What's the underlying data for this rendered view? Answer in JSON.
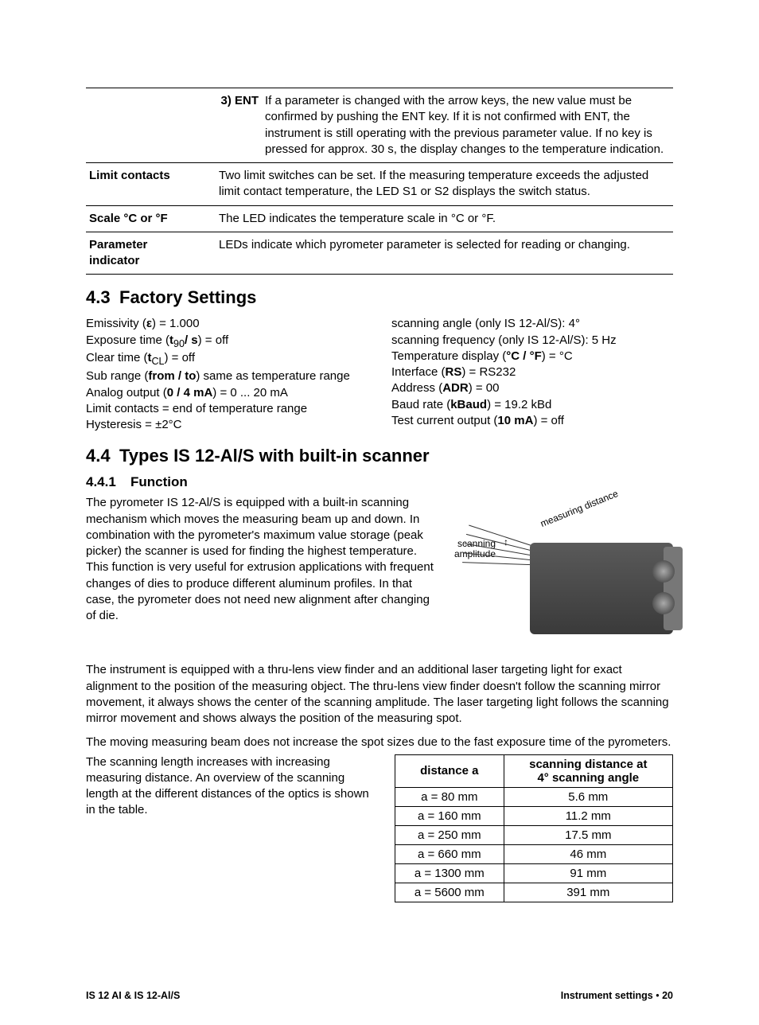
{
  "defs": {
    "row1_key": "3) ENT",
    "row1_text": "If a parameter is changed with the arrow keys, the new value must be confirmed by pushing the ENT key. If it is not confirmed with ENT, the instrument is still operating with the previous parameter value. If no key is pressed for approx. 30 s, the display changes to the temperature indication.",
    "row2_label": "Limit contacts",
    "row2_text": "Two limit switches can be set. If the measuring temperature exceeds the adjusted limit contact temperature, the LED S1 or S2 displays the switch status.",
    "row3_label": "Scale °C or °F",
    "row3_text": "The LED indicates the temperature scale in °C or °F.",
    "row4_label_l1": "Parameter",
    "row4_label_l2": "indicator",
    "row4_text": "LEDs indicate which pyrometer parameter is selected for reading or changing."
  },
  "sec43": {
    "num": "4.3",
    "title": "Factory Settings",
    "left": {
      "l1_a": "Emissivity (",
      "l1_b": ") = 1.000",
      "l2_a": "Exposure time (",
      "l2_b": "t",
      "l2_c": "90",
      "l2_d": "/ s",
      "l2_e": ") = off",
      "l3_a": "Clear time (",
      "l3_b": "t",
      "l3_c": "CL",
      "l3_d": ") = off",
      "l4_a": "Sub range (",
      "l4_b": "from / to",
      "l4_c": ") same as temperature range",
      "l5_a": "Analog output (",
      "l5_b": "0 / 4 mA",
      "l5_c": ") = 0 ... 20 mA",
      "l6": "Limit contacts = end of temperature range",
      "l7": "Hysteresis = ±2°C"
    },
    "right": {
      "r1": "scanning angle (only IS 12-Al/S): 4°",
      "r2": "scanning frequency (only IS 12-Al/S): 5 Hz",
      "r3_a": "Temperature display (",
      "r3_b": "°C / °F",
      "r3_c": ") = °C",
      "r4_a": "Interface (",
      "r4_b": "RS",
      "r4_c": ") = RS232",
      "r5_a": "Address (",
      "r5_b": "ADR",
      "r5_c": ") = 00",
      "r6_a": "Baud rate (",
      "r6_b": "kBaud",
      "r6_c": ") = 19.2 kBd",
      "r7_a": "Test current output (",
      "r7_b": "10 mA",
      "r7_c": ") = off"
    }
  },
  "sec44": {
    "num": "4.4",
    "title": "Types IS 12-Al/S with built-in scanner",
    "subnum": "4.4.1",
    "subtitle": "Function",
    "fig_meas": "measuring distance",
    "fig_scan_l1": "scanning",
    "fig_scan_l2": "amplitude",
    "p1": "The pyrometer IS 12-Al/S is equipped with a built-in scanning mechanism which moves the measuring beam up and down. In combination with the pyrometer's maximum value storage (peak picker) the scanner is used for finding the highest temperature. This function is very useful for extrusion applications with frequent changes of dies to produce different aluminum profiles. In that case, the pyrometer does not need new alignment after changing of die.",
    "p2": "The instrument is equipped with a thru-lens view finder and an additional laser targeting light for exact alignment to the position of the measuring object. The thru-lens view finder doesn't follow the scanning mirror movement, it always shows the center of the scanning amplitude. The laser targeting light follows the scanning mirror movement and shows always the position of the measuring spot.",
    "p3": "The moving measuring beam does not increase the spot sizes due to the fast exposure time of the pyrometers.",
    "p4": "The scanning length increases with increasing measuring distance. An overview of the scanning length at the different distances of the optics is shown in the table."
  },
  "scan_table": {
    "h1": "distance a",
    "h2_l1": "scanning distance at",
    "h2_l2": "4° scanning angle",
    "rows": [
      {
        "d": "a = 80 mm",
        "s": "5.6 mm"
      },
      {
        "d": "a = 160 mm",
        "s": "11.2 mm"
      },
      {
        "d": "a = 250 mm",
        "s": "17.5 mm"
      },
      {
        "d": "a = 660 mm",
        "s": "46 mm"
      },
      {
        "d": "a = 1300 mm",
        "s": "91 mm"
      },
      {
        "d": "a = 5600 mm",
        "s": "391 mm"
      }
    ]
  },
  "footer": {
    "left": "IS 12 AI & IS 12-Al/S",
    "right_section": "Instrument settings",
    "right_page": "20"
  }
}
